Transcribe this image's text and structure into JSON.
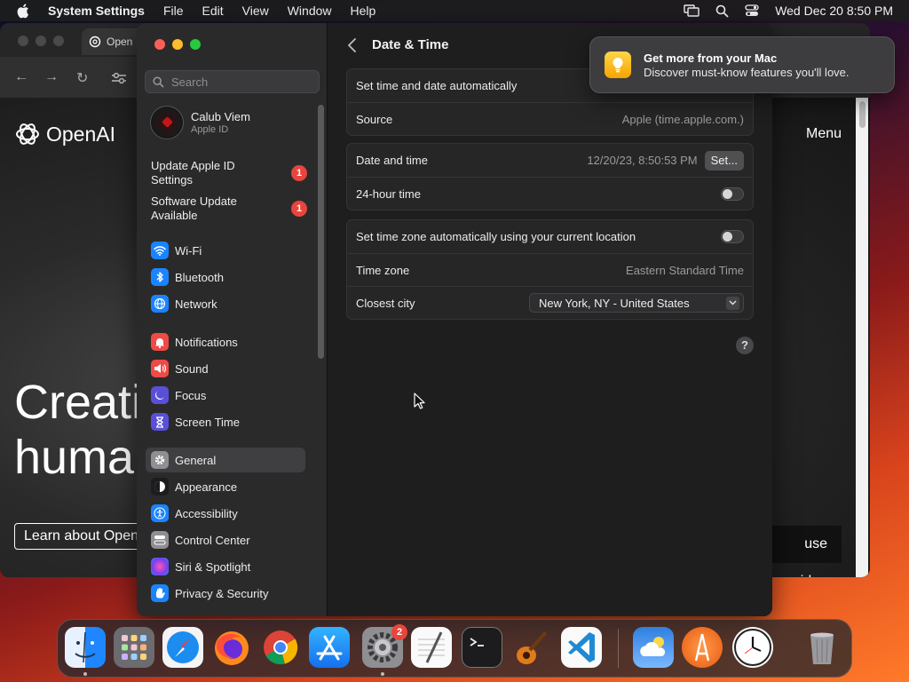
{
  "menubar": {
    "app_name": "System Settings",
    "items": [
      "File",
      "Edit",
      "View",
      "Window",
      "Help"
    ],
    "clock": "Wed Dec 20  8:50 PM"
  },
  "browser": {
    "tab_title": "Open",
    "logo_text": "OpenAI",
    "menu_label": "Menu",
    "hero_line1": "Creati",
    "hero_line2": "huma",
    "learn_button": "Learn about Open",
    "video_button": "use video"
  },
  "settings": {
    "search_placeholder": "Search",
    "user": {
      "name": "Calub Viem",
      "subtitle": "Apple ID"
    },
    "alerts": [
      {
        "label": "Update Apple ID Settings",
        "badge": "1"
      },
      {
        "label": "Software Update Available",
        "badge": "1"
      }
    ],
    "sidebar": {
      "group1": [
        {
          "label": "Wi-Fi",
          "icon": "wifi-icon",
          "color": "#1a84ff"
        },
        {
          "label": "Bluetooth",
          "icon": "bluetooth-icon",
          "color": "#1a84ff"
        },
        {
          "label": "Network",
          "icon": "globe-icon",
          "color": "#1a84ff"
        }
      ],
      "group2": [
        {
          "label": "Notifications",
          "icon": "bell-icon",
          "color": "#ef4a45"
        },
        {
          "label": "Sound",
          "icon": "speaker-icon",
          "color": "#ef4a45"
        },
        {
          "label": "Focus",
          "icon": "moon-icon",
          "color": "#5a4fd8"
        },
        {
          "label": "Screen Time",
          "icon": "hourglass-icon",
          "color": "#5a4fd8"
        }
      ],
      "group3": [
        {
          "label": "General",
          "icon": "gear-icon",
          "color": "#8e8e93",
          "selected": true
        },
        {
          "label": "Appearance",
          "icon": "appearance-icon",
          "color": "#1c1c1e"
        },
        {
          "label": "Accessibility",
          "icon": "accessibility-icon",
          "color": "#1a84ff"
        },
        {
          "label": "Control Center",
          "icon": "control-center-icon",
          "color": "#8e8e93"
        },
        {
          "label": "Siri & Spotlight",
          "icon": "siri-icon",
          "color": "#b04ad8"
        },
        {
          "label": "Privacy & Security",
          "icon": "hand-icon",
          "color": "#1a84ff"
        }
      ]
    },
    "page_title": "Date & Time",
    "group_auto": {
      "set_auto_label": "Set time and date automatically",
      "source_label": "Source",
      "source_value": "Apple (time.apple.com.)"
    },
    "group_datetime": {
      "datetime_label": "Date and time",
      "datetime_value": "12/20/23, 8:50:53 PM",
      "set_button": "Set...",
      "hour24_label": "24-hour time"
    },
    "group_timezone": {
      "tz_auto_label": "Set time zone automatically using your current location",
      "tz_label": "Time zone",
      "tz_value": "Eastern Standard Time",
      "city_label": "Closest city",
      "city_value": "New York, NY - United States"
    },
    "help_label": "?"
  },
  "notification": {
    "title": "Get more from your Mac",
    "body": "Discover must-know features you'll love."
  },
  "dock": {
    "settings_badge": "2",
    "apps": [
      "finder-icon",
      "launchpad-icon",
      "safari-icon",
      "firefox-icon",
      "chrome-icon",
      "app-store-icon",
      "system-settings-icon",
      "textedit-icon",
      "terminal-icon",
      "garageband-icon",
      "vscode-icon",
      "weather-icon",
      "instruments-icon",
      "clock-icon",
      "trash-icon"
    ]
  }
}
